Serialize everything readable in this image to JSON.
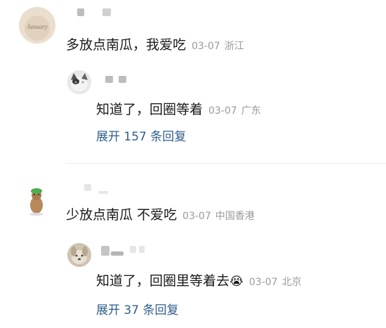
{
  "comments": [
    {
      "text": "多放点南瓜，我爱吃",
      "date": "03-07",
      "location": "浙江",
      "avatar_text": "January",
      "reply": {
        "text": "知道了，回圈等着",
        "date": "03-07",
        "location": "广东",
        "more_label": "展开 157 条回复"
      }
    },
    {
      "text": "少放点南瓜 不爱吃",
      "date": "03-07",
      "location": "中国香港",
      "reply": {
        "text": "知道了，回圈里等着去",
        "emoji": "😭",
        "date": "03-07",
        "location": "北京",
        "more_label": "展开 37 条回复"
      }
    }
  ]
}
